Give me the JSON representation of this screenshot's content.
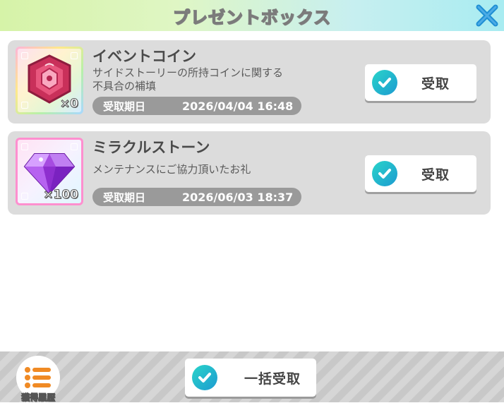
{
  "header": {
    "title": "プレゼントボックス",
    "close_icon": "close-icon"
  },
  "colors": {
    "accent_check": "#1fb6cf",
    "card_bg": "#dcdcdc",
    "pill_bg": "#9a9a9a"
  },
  "items": [
    {
      "name": "イベントコイン",
      "description_line1": "サイドストーリーの所持コインに関する",
      "description_line2": "不具合の補填",
      "quantity": "×0",
      "date_label": "受取期日",
      "date_value": "2026/04/04 16:48",
      "claim_label": "受取",
      "icon": "event-coin-icon"
    },
    {
      "name": "ミラクルストーン",
      "description_line1": "メンテナンスにご協力頂いたお礼",
      "description_line2": "",
      "quantity": "×100",
      "date_label": "受取期日",
      "date_value": "2026/06/03 18:37",
      "claim_label": "受取",
      "icon": "miracle-stone-icon"
    }
  ],
  "footer": {
    "history_label": "獲得履歴",
    "claim_all_label": "一括受取"
  }
}
